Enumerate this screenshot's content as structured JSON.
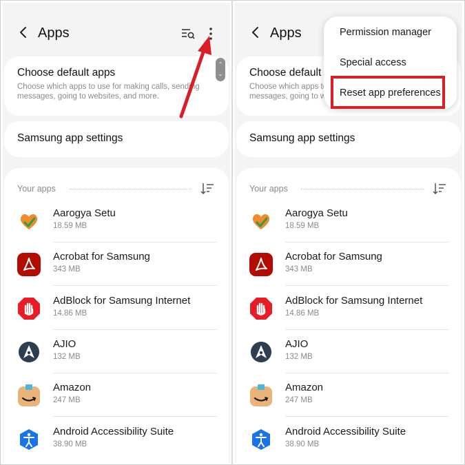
{
  "screen": {
    "title": "Apps",
    "default_apps": {
      "title": "Choose default apps",
      "description": "Choose which apps to use for making calls, sending messages, going to websites, and more."
    },
    "samsung_settings": "Samsung app settings",
    "section_label": "Your apps",
    "apps": [
      {
        "name": "Aarogya Setu",
        "size": "18.59 MB",
        "icon": "aarogya-setu-icon"
      },
      {
        "name": "Acrobat for Samsung",
        "size": "343 MB",
        "icon": "acrobat-icon"
      },
      {
        "name": "AdBlock for Samsung Internet",
        "size": "14.86 MB",
        "icon": "adblock-icon"
      },
      {
        "name": "AJIO",
        "size": "132 MB",
        "icon": "ajio-icon"
      },
      {
        "name": "Amazon",
        "size": "247 MB",
        "icon": "amazon-icon"
      },
      {
        "name": "Android Accessibility Suite",
        "size": "38.90 MB",
        "icon": "accessibility-icon"
      }
    ]
  },
  "menu": {
    "items": [
      "Permission manager",
      "Special access",
      "Reset app preferences"
    ]
  },
  "colors": {
    "annotation_red": "#d81f26",
    "acrobat_red": "#b30b00",
    "adblock_red": "#e81c24",
    "ajio_dark": "#2c3e50",
    "amazon_tan": "#e9b37a",
    "accessibility_blue": "#1a73e8"
  }
}
